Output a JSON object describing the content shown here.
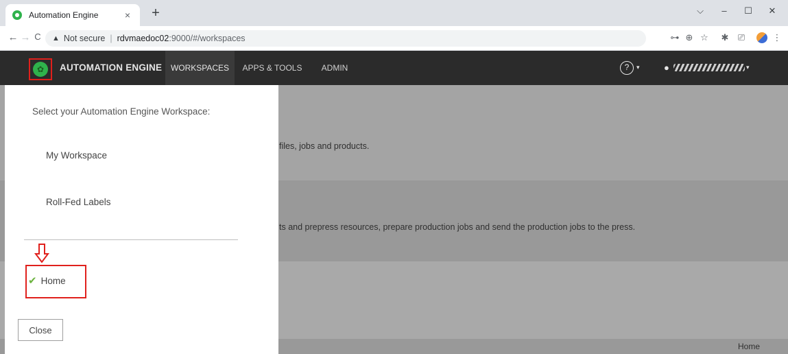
{
  "browser": {
    "tab_title": "Automation Engine",
    "tab_close": "×",
    "new_tab": "+",
    "window_controls": {
      "minimize": "–",
      "maximize": "☐",
      "close": "✕",
      "tab_search": "⌵"
    },
    "nav": {
      "back": "←",
      "forward": "→",
      "reload": "C"
    },
    "security_label": "Not secure",
    "url_host": "rdvmaedoc02",
    "url_path": ":9000/#/workspaces",
    "url_separator": "|",
    "toolbar_icons": {
      "key": "⊶",
      "zoom": "⊕",
      "bookmark": "☆",
      "extensions": "✱",
      "cast": "⎚",
      "menu": "⋮"
    }
  },
  "app": {
    "title": "AUTOMATION ENGINE",
    "nav": [
      "WORKSPACES",
      "APPS & TOOLS",
      "ADMIN"
    ],
    "help_label": "?",
    "caret": "▾"
  },
  "background": {
    "text_1": "files, jobs and products.",
    "text_2": "ts and prepress resources, prepare production jobs and send the production jobs to the press.",
    "footer_home": "Home"
  },
  "panel": {
    "title": "Select your Automation Engine Workspace:",
    "workspaces": [
      "My Workspace",
      "Roll-Fed Labels"
    ],
    "home_label": "Home",
    "close_label": "Close"
  },
  "colors": {
    "highlight_red": "#e0201c",
    "app_header": "#2b2b2b",
    "logo_green": "#2fb24c",
    "check_green": "#6cb33f",
    "overlay_gray": "#a4a4a4"
  }
}
